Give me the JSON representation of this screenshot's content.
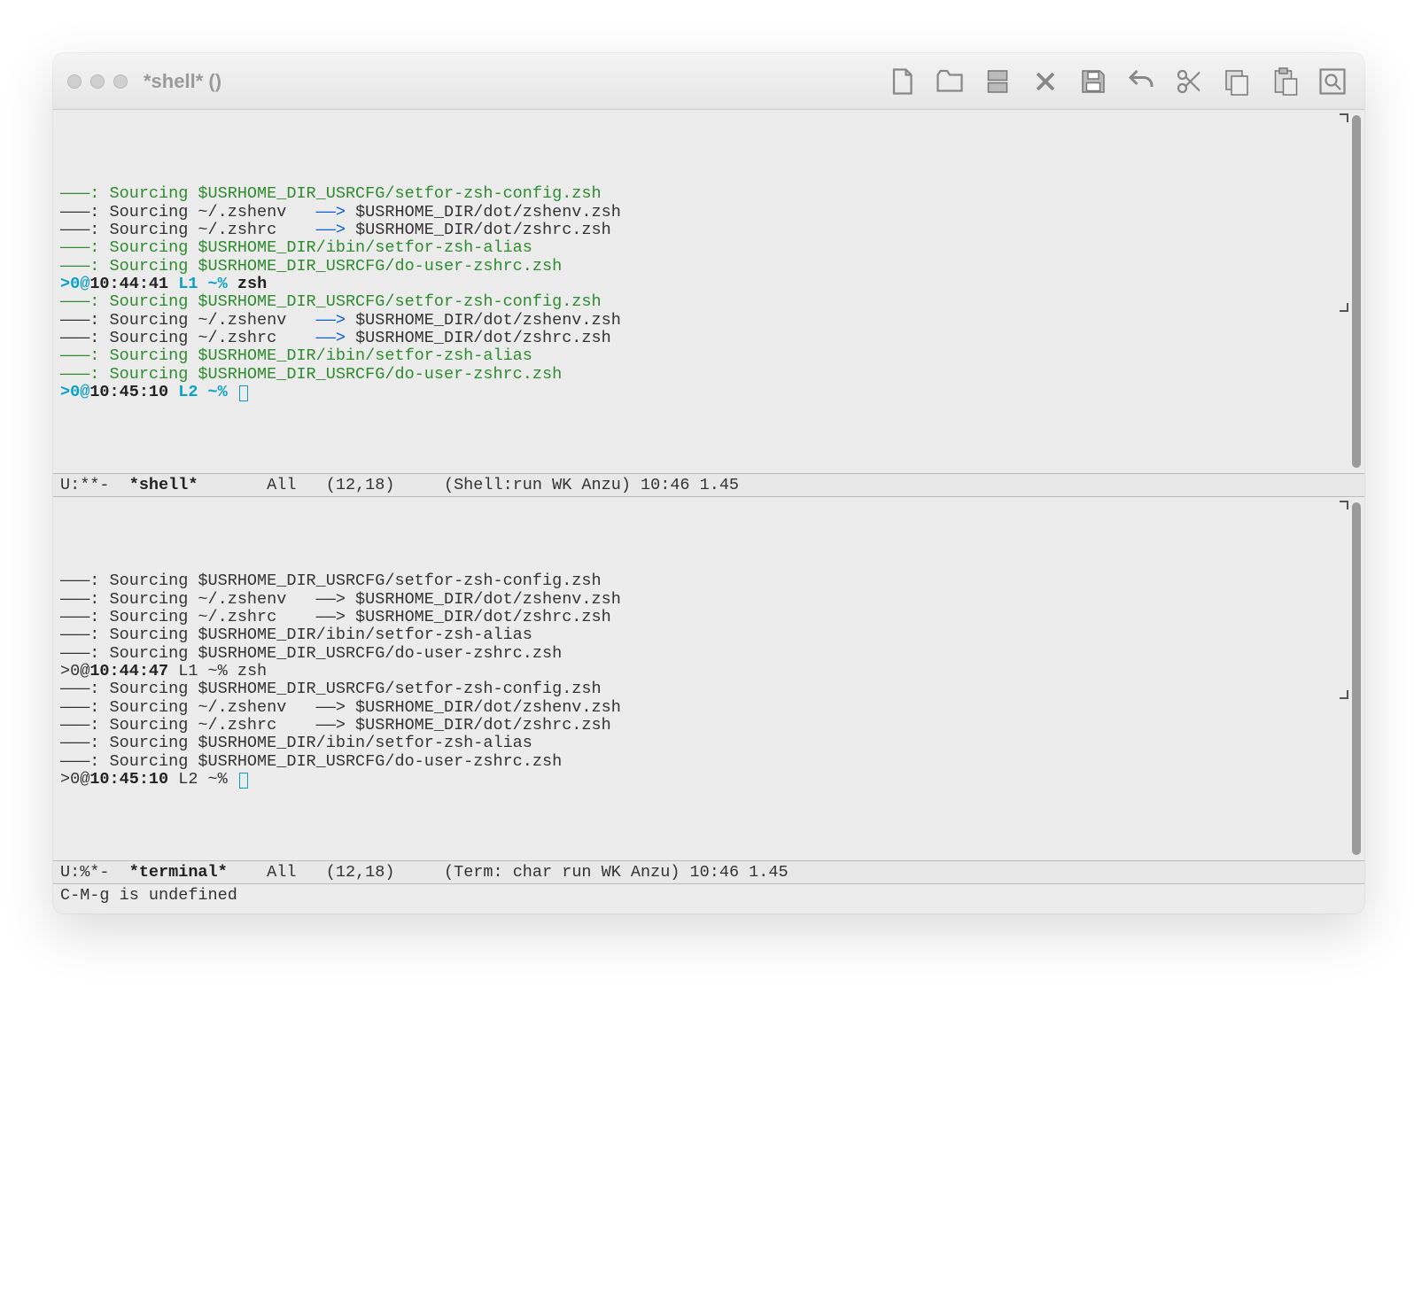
{
  "window": {
    "title": "*shell* ()"
  },
  "toolbar_icons": [
    "new-file",
    "open-folder",
    "save-diskstack",
    "close-x",
    "save-disk",
    "undo",
    "cut-scissors",
    "copy",
    "paste",
    "search"
  ],
  "pane_top": {
    "lines": [
      {
        "segs": [
          {
            "t": "———: Sourcing $USRHOME_DIR_USRCFG/setfor-zsh-config.zsh",
            "c": "green"
          }
        ]
      },
      {
        "segs": [
          {
            "t": "———: Sourcing ~/.zshenv   ",
            "c": ""
          },
          {
            "t": "——>",
            "c": "blue"
          },
          {
            "t": " $USRHOME_DIR/dot/zshenv.zsh",
            "c": ""
          }
        ]
      },
      {
        "segs": [
          {
            "t": "———: Sourcing ~/.zshrc    ",
            "c": ""
          },
          {
            "t": "——>",
            "c": "blue"
          },
          {
            "t": " $USRHOME_DIR/dot/zshrc.zsh",
            "c": ""
          }
        ]
      },
      {
        "segs": [
          {
            "t": "———: Sourcing $USRHOME_DIR/ibin/setfor-zsh-alias",
            "c": "green"
          }
        ]
      },
      {
        "segs": [
          {
            "t": "———: Sourcing $USRHOME_DIR_USRCFG/do-user-zshrc.zsh",
            "c": "green"
          }
        ]
      },
      {
        "segs": [
          {
            "t": ">0@",
            "c": "cyanbold"
          },
          {
            "t": "10:44:41",
            "c": "bold"
          },
          {
            "t": " L1 ~%",
            "c": "cyanbold"
          },
          {
            "t": " zsh",
            "c": "bold"
          }
        ]
      },
      {
        "segs": [
          {
            "t": "———: Sourcing $USRHOME_DIR_USRCFG/setfor-zsh-config.zsh",
            "c": "green"
          }
        ]
      },
      {
        "segs": [
          {
            "t": "———: Sourcing ~/.zshenv   ",
            "c": ""
          },
          {
            "t": "——>",
            "c": "blue"
          },
          {
            "t": " $USRHOME_DIR/dot/zshenv.zsh",
            "c": ""
          }
        ]
      },
      {
        "segs": [
          {
            "t": "———: Sourcing ~/.zshrc    ",
            "c": ""
          },
          {
            "t": "——>",
            "c": "blue"
          },
          {
            "t": " $USRHOME_DIR/dot/zshrc.zsh",
            "c": ""
          }
        ]
      },
      {
        "segs": [
          {
            "t": "———: Sourcing $USRHOME_DIR/ibin/setfor-zsh-alias",
            "c": "green"
          }
        ]
      },
      {
        "segs": [
          {
            "t": "———: Sourcing $USRHOME_DIR_USRCFG/do-user-zshrc.zsh",
            "c": "green"
          }
        ]
      },
      {
        "segs": [
          {
            "t": ">0@",
            "c": "cyanbold"
          },
          {
            "t": "10:45:10",
            "c": "bold"
          },
          {
            "t": " L2 ~% ",
            "c": "cyanbold"
          }
        ],
        "cursor": true
      }
    ],
    "modeline": {
      "prefix": "U:**-  ",
      "buf": "*shell*",
      "mid": "       All   (12,18)     (Shell:run WK Anzu) 10:46 1.45"
    }
  },
  "pane_bottom": {
    "lines": [
      {
        "segs": [
          {
            "t": "———: Sourcing $USRHOME_DIR_USRCFG/setfor-zsh-config.zsh",
            "c": ""
          }
        ]
      },
      {
        "segs": [
          {
            "t": "———: Sourcing ~/.zshenv   ——> $USRHOME_DIR/dot/zshenv.zsh",
            "c": ""
          }
        ]
      },
      {
        "segs": [
          {
            "t": "———: Sourcing ~/.zshrc    ——> $USRHOME_DIR/dot/zshrc.zsh",
            "c": ""
          }
        ]
      },
      {
        "segs": [
          {
            "t": "———: Sourcing $USRHOME_DIR/ibin/setfor-zsh-alias",
            "c": ""
          }
        ]
      },
      {
        "segs": [
          {
            "t": "———: Sourcing $USRHOME_DIR_USRCFG/do-user-zshrc.zsh",
            "c": ""
          }
        ]
      },
      {
        "segs": [
          {
            "t": ">0@",
            "c": ""
          },
          {
            "t": "10:44:47",
            "c": "bold"
          },
          {
            "t": " L1 ~% zsh",
            "c": ""
          }
        ]
      },
      {
        "segs": [
          {
            "t": "———: Sourcing $USRHOME_DIR_USRCFG/setfor-zsh-config.zsh",
            "c": ""
          }
        ]
      },
      {
        "segs": [
          {
            "t": "———: Sourcing ~/.zshenv   ——> $USRHOME_DIR/dot/zshenv.zsh",
            "c": ""
          }
        ]
      },
      {
        "segs": [
          {
            "t": "———: Sourcing ~/.zshrc    ——> $USRHOME_DIR/dot/zshrc.zsh",
            "c": ""
          }
        ]
      },
      {
        "segs": [
          {
            "t": "———: Sourcing $USRHOME_DIR/ibin/setfor-zsh-alias",
            "c": ""
          }
        ]
      },
      {
        "segs": [
          {
            "t": "———: Sourcing $USRHOME_DIR_USRCFG/do-user-zshrc.zsh",
            "c": ""
          }
        ]
      },
      {
        "segs": [
          {
            "t": ">0@",
            "c": ""
          },
          {
            "t": "10:45:10",
            "c": "bold"
          },
          {
            "t": " L2 ~% ",
            "c": ""
          }
        ],
        "cursor": true
      }
    ],
    "modeline": {
      "prefix": "U:%*-  ",
      "buf": "*terminal*",
      "mid": "    All   (12,18)     (Term: char run WK Anzu) 10:46 1.45"
    }
  },
  "minibuffer": "C-M-g is undefined"
}
